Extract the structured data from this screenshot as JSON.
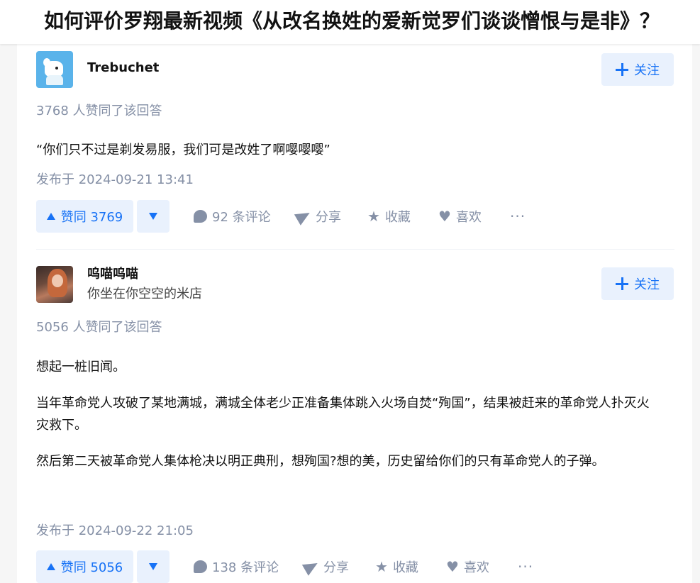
{
  "page": {
    "question_title": "如何评价罗翔最新视频《从改名换姓的爱新觉罗们谈谈憎恨与是非》？"
  },
  "answers": [
    {
      "author": {
        "name": "Trebuchet",
        "bio": ""
      },
      "follow_label": "关注",
      "voteup_text": "3768 人赞同了该回答",
      "paragraphs": [
        "“你们只不过是剃发易服，我们可是改姓了啊嘤嘤嘤”"
      ],
      "publish_time": "发布于 2024-09-21 13:41",
      "actions": {
        "voteup_label": "赞同 3769",
        "comments_label": "92 条评论",
        "share_label": "分享",
        "favorite_label": "收藏",
        "like_label": "喜欢",
        "more_label": "···"
      }
    },
    {
      "author": {
        "name": "呜喵呜喵",
        "bio": "你坐在你空空的米店"
      },
      "follow_label": "关注",
      "voteup_text": "5056 人赞同了该回答",
      "paragraphs": [
        "想起一桩旧闻。",
        "当年革命党人攻破了某地满城，满城全体老少正准备集体跳入火场自焚“殉国”，结果被赶来的革命党人扑灭火灾救下。",
        "然后第二天被革命党人集体枪决以明正典刑，想殉国?想的美，历史留给你们的只有革命党人的子弹。"
      ],
      "publish_time": "发布于 2024-09-22 21:05",
      "actions": {
        "voteup_label": "赞同 5056",
        "comments_label": "138 条评论",
        "share_label": "分享",
        "favorite_label": "收藏",
        "like_label": "喜欢",
        "more_label": "···"
      }
    }
  ],
  "icons": {
    "comment": "comment-bubble-icon",
    "share": "paper-plane-icon",
    "favorite": "star-icon",
    "like": "heart-icon",
    "follow": "plus-icon"
  },
  "colors": {
    "accent": "#1772f6",
    "accent_bg": "#e9f1fd",
    "meta_text": "#8590a6",
    "page_bg": "#f6f6f6"
  }
}
